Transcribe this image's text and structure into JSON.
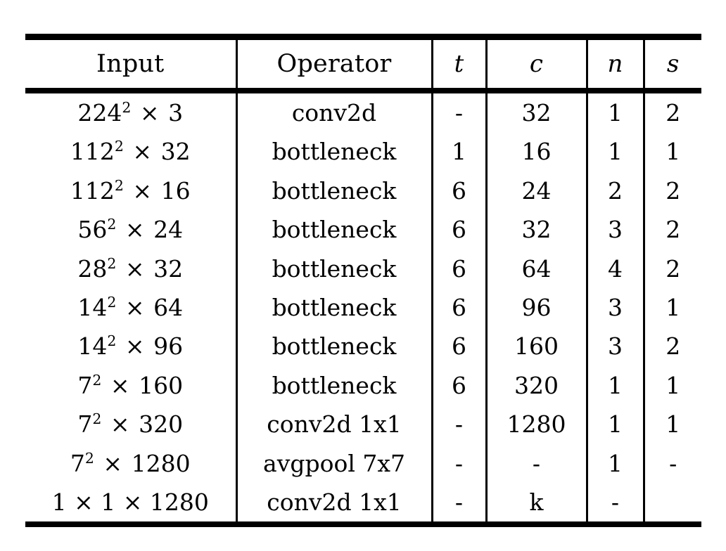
{
  "table": {
    "columns": [
      {
        "key": "input",
        "label": "Input",
        "italic": false
      },
      {
        "key": "operator",
        "label": "Operator",
        "italic": false
      },
      {
        "key": "t",
        "label": "t",
        "italic": true
      },
      {
        "key": "c",
        "label": "c",
        "italic": true
      },
      {
        "key": "n",
        "label": "n",
        "italic": true
      },
      {
        "key": "s",
        "label": "s",
        "italic": true
      }
    ],
    "rows": [
      {
        "input_base": "224",
        "input_exp": "2",
        "input_tail": "3",
        "input_text": "224² × 3",
        "operator": "conv2d",
        "t": "-",
        "c": "32",
        "n": "1",
        "s": "2"
      },
      {
        "input_base": "112",
        "input_exp": "2",
        "input_tail": "32",
        "input_text": "112² × 32",
        "operator": "bottleneck",
        "t": "1",
        "c": "16",
        "n": "1",
        "s": "1"
      },
      {
        "input_base": "112",
        "input_exp": "2",
        "input_tail": "16",
        "input_text": "112² × 16",
        "operator": "bottleneck",
        "t": "6",
        "c": "24",
        "n": "2",
        "s": "2"
      },
      {
        "input_base": "56",
        "input_exp": "2",
        "input_tail": "24",
        "input_text": "56² × 24",
        "operator": "bottleneck",
        "t": "6",
        "c": "32",
        "n": "3",
        "s": "2"
      },
      {
        "input_base": "28",
        "input_exp": "2",
        "input_tail": "32",
        "input_text": "28² × 32",
        "operator": "bottleneck",
        "t": "6",
        "c": "64",
        "n": "4",
        "s": "2"
      },
      {
        "input_base": "14",
        "input_exp": "2",
        "input_tail": "64",
        "input_text": "14² × 64",
        "operator": "bottleneck",
        "t": "6",
        "c": "96",
        "n": "3",
        "s": "1"
      },
      {
        "input_base": "14",
        "input_exp": "2",
        "input_tail": "96",
        "input_text": "14² × 96",
        "operator": "bottleneck",
        "t": "6",
        "c": "160",
        "n": "3",
        "s": "2"
      },
      {
        "input_base": "7",
        "input_exp": "2",
        "input_tail": "160",
        "input_text": "7² × 160",
        "operator": "bottleneck",
        "t": "6",
        "c": "320",
        "n": "1",
        "s": "1"
      },
      {
        "input_base": "7",
        "input_exp": "2",
        "input_tail": "320",
        "input_text": "7² × 320",
        "operator": "conv2d 1x1",
        "t": "-",
        "c": "1280",
        "n": "1",
        "s": "1"
      },
      {
        "input_base": "7",
        "input_exp": "2",
        "input_tail": "1280",
        "input_text": "7² × 1280",
        "operator": "avgpool 7x7",
        "t": "-",
        "c": "-",
        "n": "1",
        "s": "-"
      },
      {
        "input_base": "1",
        "input_exp": "",
        "input_tail": "1 × 1280",
        "input_text": "1 × 1 × 1280",
        "operator": "conv2d 1x1",
        "t": "-",
        "c": "k",
        "n": "-",
        "s": ""
      }
    ]
  },
  "style": {
    "rule_color": "#000000",
    "text_color": "#000000",
    "background": "#ffffff"
  }
}
